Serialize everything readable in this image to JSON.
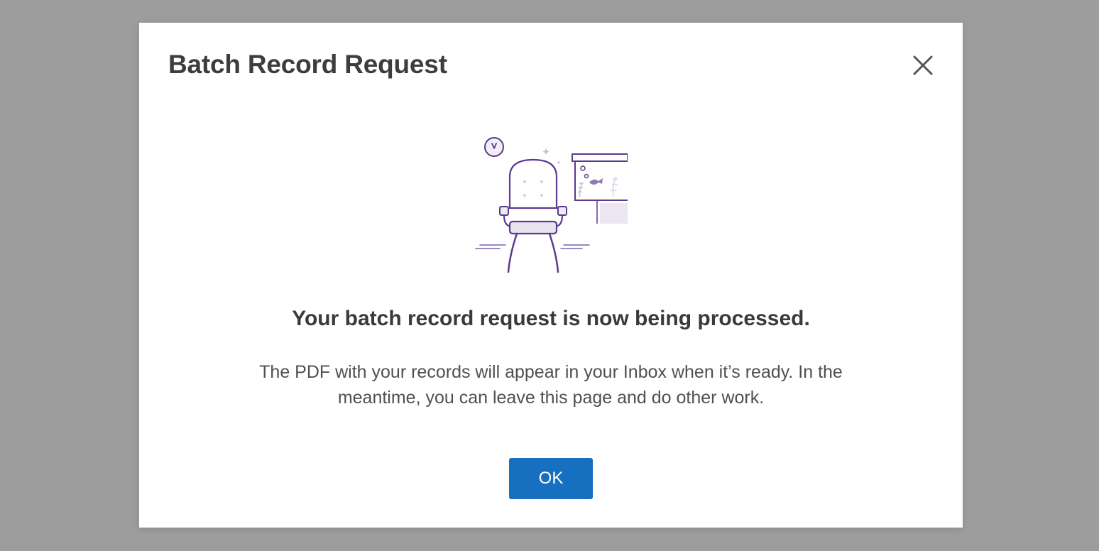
{
  "dialog": {
    "title": "Batch Record Request",
    "close_icon": "close-icon",
    "illustration": "waiting-room-chair-illustration",
    "headline": "Your batch record request is now being processed.",
    "body": "The PDF with your records will appear in your Inbox when it’s ready. In the meantime, you can leave this page and do other work.",
    "ok_label": "OK"
  },
  "colors": {
    "overlay": "#9d9d9d",
    "modal_background": "#ffffff",
    "primary_button": "#1670bf",
    "illustration_accent": "#5b3a8f",
    "title_text": "#3d3d3d",
    "body_text": "#505050"
  }
}
